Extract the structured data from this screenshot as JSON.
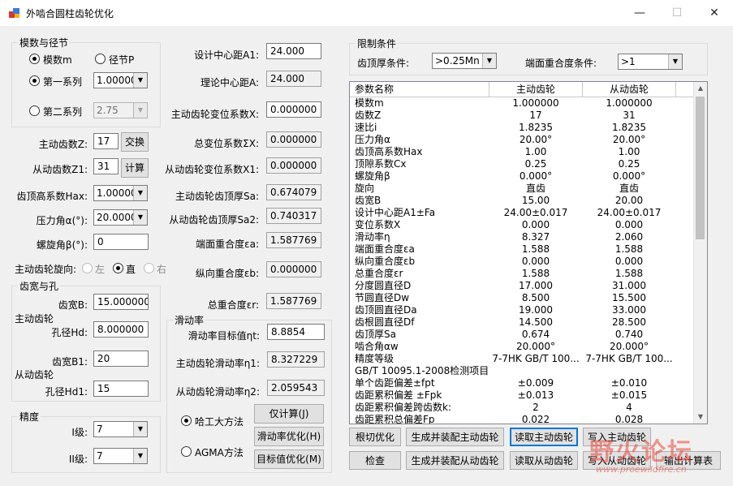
{
  "window": {
    "title": "外啮合圆柱齿轮优化",
    "minimize": "—",
    "maximize": "☐",
    "close": "✕"
  },
  "modulus_group": {
    "title": "模数与径节",
    "radio_modulus": "模数m",
    "radio_diametral": "径节P",
    "radio_series1": "第一系列",
    "series1_value": "1.00000",
    "radio_series2": "第二系列",
    "series2_value": "2.75"
  },
  "teeth": {
    "driving_label": "主动齿数Z:",
    "driving_value": "17",
    "swap_button": "交换",
    "driven_label": "从动齿数Z1:",
    "driven_value": "31",
    "calc_button": "计算"
  },
  "addendum": {
    "label": "齿顶高系数Hax:",
    "value": "1.00000"
  },
  "pressure_angle": {
    "label": "压力角α(°):",
    "value": "20.0000"
  },
  "helix_angle": {
    "label": "螺旋角β(°):",
    "value": "0"
  },
  "rotation": {
    "label": "主动齿轮旋向:",
    "left": "左",
    "straight": "直",
    "right": "右"
  },
  "width_group": {
    "title": "齿宽与孔",
    "driving_gear": "主动齿轮",
    "width_b_label": "齿宽B:",
    "width_b_value": "15.000000",
    "bore_hd_label": "孔径Hd:",
    "bore_hd_value": "8.000000",
    "driven_gear": "从动齿轮",
    "width_b1_label": "齿宽B1:",
    "width_b1_value": "20",
    "bore_hd1_label": "孔径Hd1:",
    "bore_hd1_value": "15"
  },
  "precision_group": {
    "title": "精度",
    "grade1_label": "I级:",
    "grade1_value": "7",
    "grade2_label": "II级:",
    "grade2_value": "7"
  },
  "center": {
    "design_label": "设计中心距A1:",
    "design_value": "24.000",
    "theory_label": "理论中心距A:",
    "theory_value": "24.000",
    "drive_shift_label": "主动齿轮变位系数X:",
    "drive_shift_value": "0.000000",
    "total_shift_label": "总变位系数ΣX:",
    "total_shift_value": "0.000000",
    "driven_shift_label": "从动齿轮变位系数X1:",
    "driven_shift_value": "0.000000",
    "drive_tip_label": "主动齿轮齿顶厚Sa:",
    "drive_tip_value": "0.674079",
    "driven_tip_label": "从动齿轮齿顶厚Sa2:",
    "driven_tip_value": "0.740317",
    "transverse_label": "端面重合度εa:",
    "transverse_value": "1.587769",
    "axial_label": "纵向重合度εb:",
    "axial_value": "0.000000",
    "total_label": "总重合度εr:",
    "total_value": "1.587769"
  },
  "slip_group": {
    "title": "滑动率",
    "target_label": "滑动率目标值ηt:",
    "target_value": "8.8854",
    "drive_label": "主动齿轮滑动率η1:",
    "drive_value": "8.327229",
    "driven_label": "从动齿轮滑动率η2:",
    "driven_value": "2.059543",
    "method_hit": "哈工大方法",
    "method_agma": "AGMA方法",
    "btn_calc": "仅计算(J)",
    "btn_slip_opt": "滑动率优化(H)",
    "btn_target_opt": "目标值优化(M)"
  },
  "constraints": {
    "title": "限制条件",
    "tip_label": "齿顶厚条件:",
    "tip_value": ">0.25Mn",
    "overlap_label": "端面重合度条件:",
    "overlap_value": ">1"
  },
  "table": {
    "headers": [
      "参数名称",
      "主动齿轮",
      "从动齿轮"
    ],
    "rows": [
      [
        "模数m",
        "1.000000",
        "1.000000"
      ],
      [
        "齿数Z",
        "17",
        "31"
      ],
      [
        "速比i",
        "1.8235",
        "1.8235"
      ],
      [
        "压力角α",
        "20.00°",
        "20.00°"
      ],
      [
        "齿顶高系数Hax",
        "1.00",
        "1.00"
      ],
      [
        "顶隙系数Cx",
        "0.25",
        "0.25"
      ],
      [
        "螺旋角β",
        "0.000°",
        "0.000°"
      ],
      [
        "旋向",
        "直齿",
        "直齿"
      ],
      [
        "齿宽B",
        "15.00",
        "20.00"
      ],
      [
        "设计中心距A1±Fa",
        "24.00±0.017",
        "24.00±0.017"
      ],
      [
        "变位系数X",
        "0.000",
        "0.000"
      ],
      [
        "滑动率η",
        "8.327",
        "2.060"
      ],
      [
        "端面重合度εa",
        "1.588",
        "1.588"
      ],
      [
        "纵向重合度εb",
        "0.000",
        "0.000"
      ],
      [
        "总重合度εr",
        "1.588",
        "1.588"
      ],
      [
        "分度圆直径D",
        "17.000",
        "31.000"
      ],
      [
        "节圆直径Dw",
        "8.500",
        "15.500"
      ],
      [
        "齿顶圆直径Da",
        "19.000",
        "33.000"
      ],
      [
        "齿根圆直径Df",
        "14.500",
        "28.500"
      ],
      [
        "齿顶厚Sa",
        "0.674",
        "0.740"
      ],
      [
        "啮合角αw",
        "20.000°",
        "20.000°"
      ],
      [
        "精度等级",
        "7-7HK GB/T 100...",
        "7-7HK GB/T 100..."
      ],
      [
        "GB/T 10095.1-2008检测项目",
        "",
        ""
      ],
      [
        "单个齿距偏差±fpt",
        "±0.009",
        "±0.010"
      ],
      [
        "齿距累积偏差 ±Fpk",
        "±0.013",
        "±0.015"
      ],
      [
        "齿距累积偏差跨齿数k:",
        "2",
        "4"
      ],
      [
        "齿距累积总偏差Fp",
        "0.022",
        "0.028"
      ]
    ]
  },
  "bottom_buttons": {
    "undercut": "根切优化",
    "gen_drive": "生成并装配主动齿轮",
    "read_drive": "读取主动齿轮",
    "write_drive": "写入主动齿轮",
    "check": "检查",
    "gen_driven": "生成并装配从动齿轮",
    "read_driven": "读取从动齿轮",
    "write_driven": "写入从动齿轮",
    "export": "输出计算表"
  },
  "watermark": {
    "text": "野火论坛",
    "url": "www.proewildfire.cn"
  },
  "colors": {
    "accent": "#0078d7",
    "watermark": "#e8473b"
  }
}
